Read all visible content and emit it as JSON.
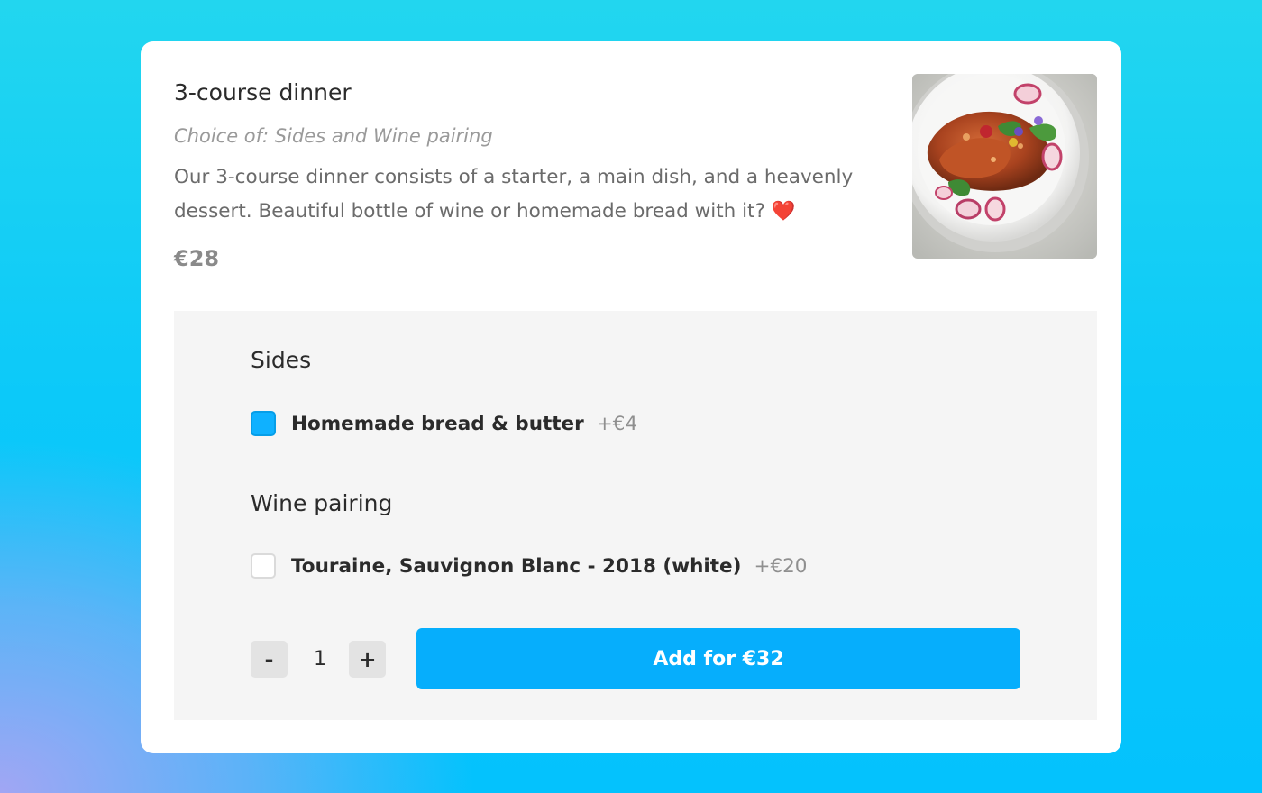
{
  "item": {
    "title": "3-course dinner",
    "subtitle": "Choice of: Sides and Wine pairing",
    "description": "Our 3-course dinner consists of a starter, a main dish, and a heavenly dessert. Beautiful bottle of wine or homemade bread with it?",
    "description_emoji": "❤️",
    "price": "€28"
  },
  "options": {
    "sides": {
      "title": "Sides",
      "items": [
        {
          "label": "Homemade bread & butter",
          "price": "+€4",
          "checked": true
        }
      ]
    },
    "wine": {
      "title": "Wine pairing",
      "items": [
        {
          "label": "Touraine, Sauvignon Blanc - 2018 (white)",
          "price": "+€20",
          "checked": false
        }
      ]
    }
  },
  "order": {
    "decrement_label": "-",
    "quantity": "1",
    "increment_label": "+",
    "add_label": "Add for €32"
  },
  "colors": {
    "accent": "#06aefc",
    "checkbox_checked": "#0fb1ff",
    "panel_bg": "#f5f5f5",
    "card_bg": "#ffffff"
  }
}
